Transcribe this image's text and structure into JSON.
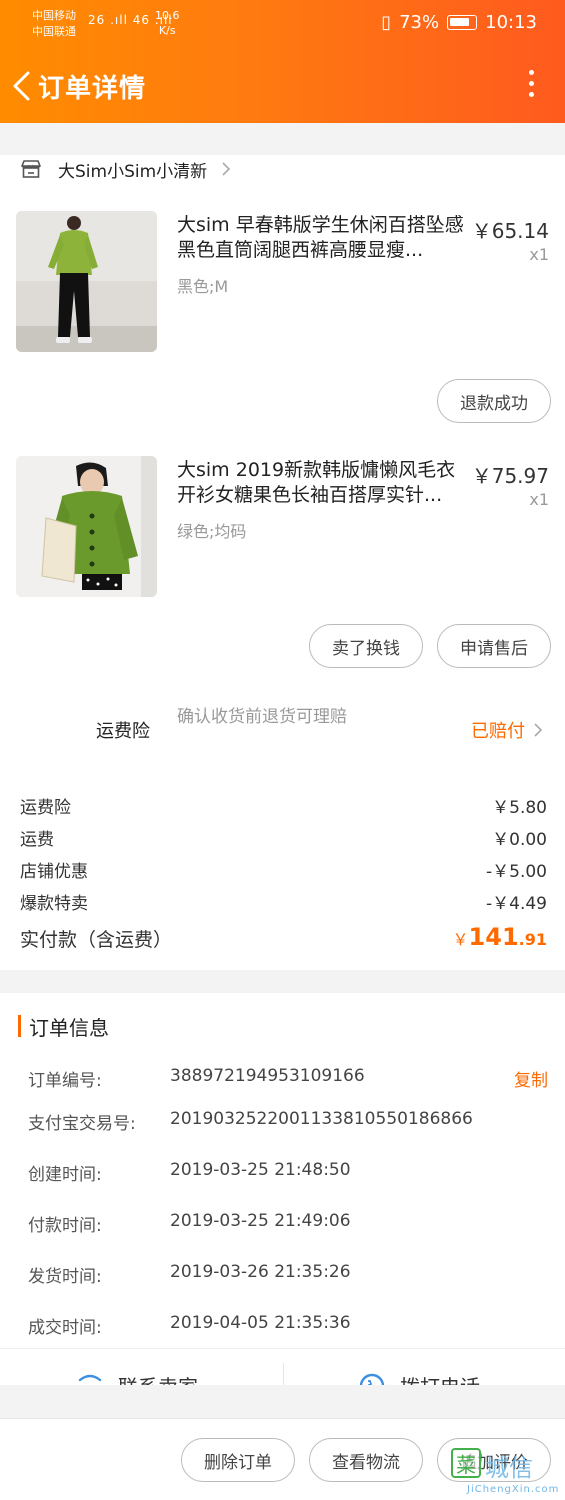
{
  "status_bar": {
    "carrier1": "中国移动",
    "carrier2": "中国联通",
    "signal1": "26 .ıll",
    "signal2": "46 .ıll",
    "speed_value": "10.6",
    "speed_unit": "K/s",
    "vibrate": "▯",
    "battery_pct": "73%",
    "time": "10:13"
  },
  "nav": {
    "title": "订单详情"
  },
  "shop": {
    "name": "大Sim小Sim小清新"
  },
  "items": [
    {
      "title": "大sim 早春韩版学生休闲百搭坠感黑色直筒阔腿西裤高腰显瘦...",
      "price": "￥65.14",
      "qty": "x1",
      "spec": "黑色;M",
      "actions": [
        "退款成功"
      ]
    },
    {
      "title": "大sim 2019新款韩版慵懒风毛衣开衫女糖果色长袖百搭厚实针...",
      "price": "￥75.97",
      "qty": "x1",
      "spec": "绿色;均码",
      "actions": [
        "卖了换钱",
        "申请售后"
      ]
    }
  ],
  "insurance": {
    "label": "运费险",
    "desc": "确认收货前退货可理赔",
    "status": "已赔付"
  },
  "fees": [
    {
      "label": "运费险",
      "value": "￥5.80"
    },
    {
      "label": "运费",
      "value": "￥0.00"
    },
    {
      "label": "店铺优惠",
      "value": "-￥5.00"
    },
    {
      "label": "爆款特卖",
      "value": "-￥4.49"
    }
  ],
  "total": {
    "label": "实付款（含运费）",
    "currency": "￥",
    "integer": "141",
    "decimal": ".91"
  },
  "order_info": {
    "title": "订单信息",
    "copy_label": "复制",
    "rows": [
      {
        "label": "订单编号:",
        "value": "388972194953109166"
      },
      {
        "label": "支付宝交易号:",
        "value": "2019032522001133810550186866"
      },
      {
        "label": "创建时间:",
        "value": "2019-03-25 21:48:50"
      },
      {
        "label": "付款时间:",
        "value": "2019-03-25 21:49:06"
      },
      {
        "label": "发货时间:",
        "value": "2019-03-26 21:35:26"
      },
      {
        "label": "成交时间:",
        "value": "2019-04-05 21:35:36"
      }
    ],
    "contact_seller": "联系卖家",
    "call_phone": "拨打电话"
  },
  "bottom_actions": [
    "删除订单",
    "查看物流",
    "追加评价"
  ],
  "watermark": {
    "mark": "菜",
    "text": "城信",
    "sub": "JiChengXin.com"
  }
}
